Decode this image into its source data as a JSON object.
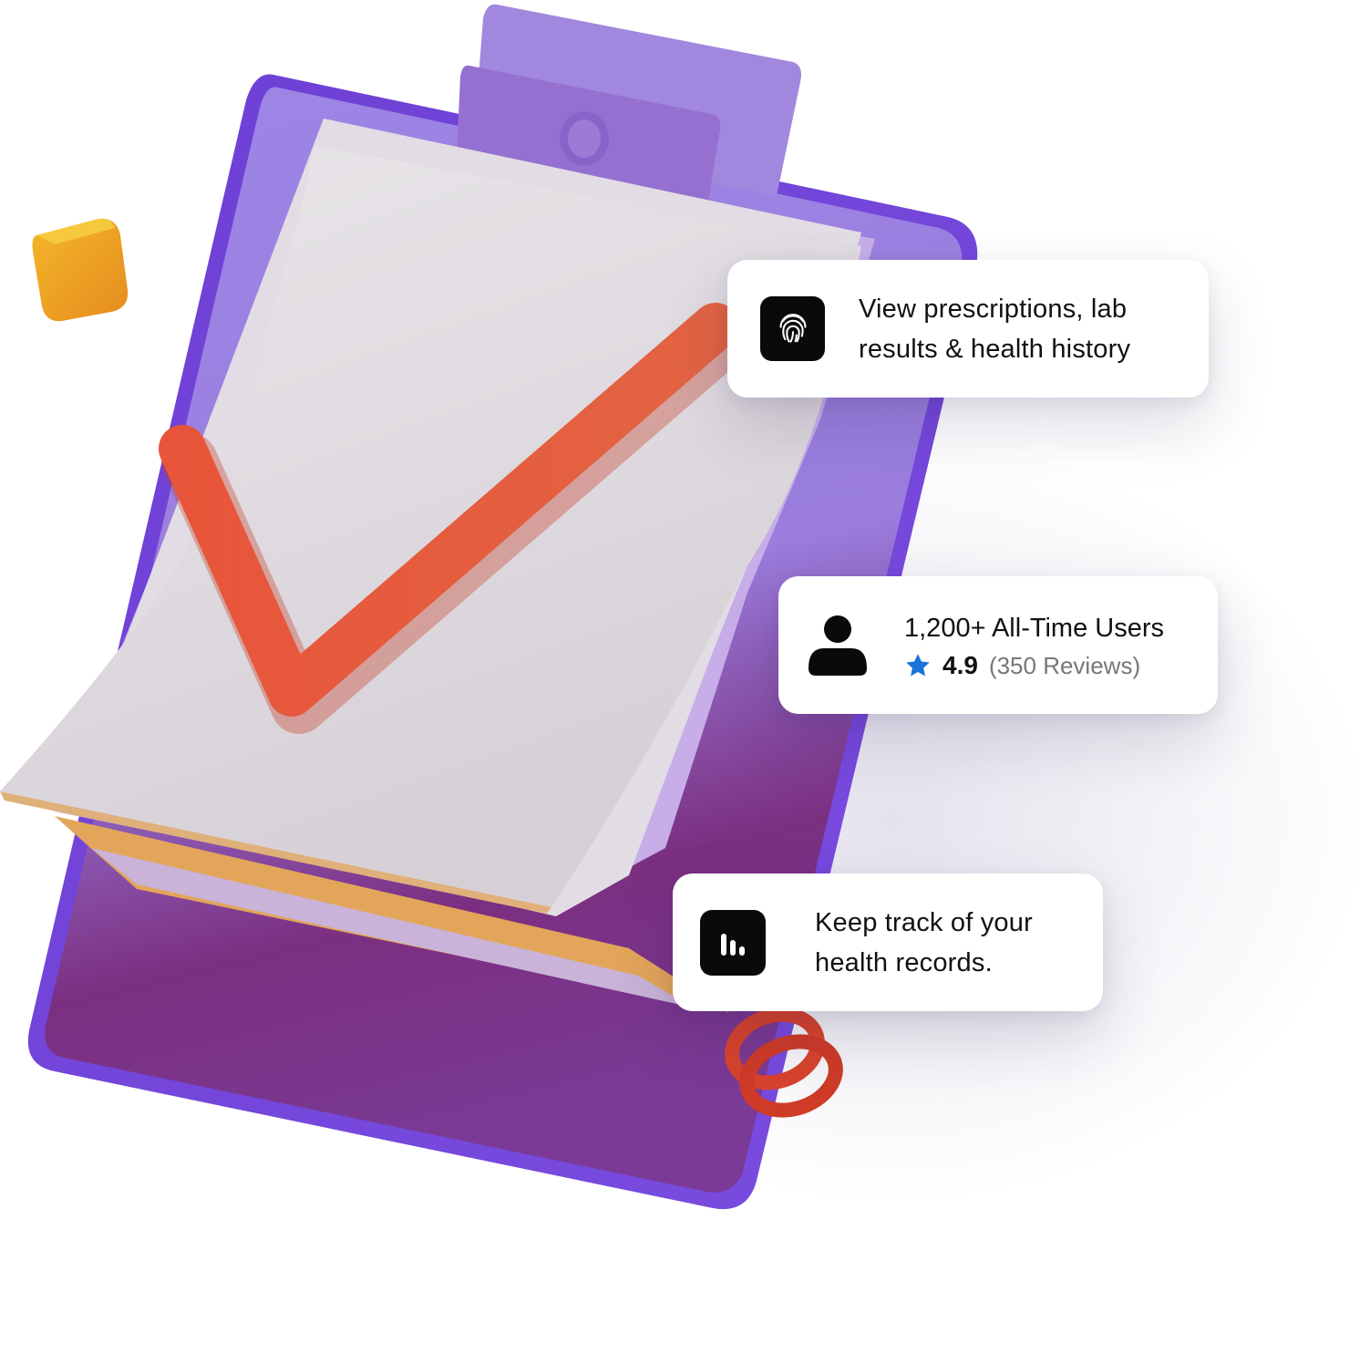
{
  "cards": {
    "records": {
      "icon": "fingerprint-icon",
      "line1": "View prescriptions, lab",
      "line2": "results & health history"
    },
    "users": {
      "icon": "user-icon",
      "title": "1,200+ All-Time Users",
      "rating": "4.9",
      "reviews": "(350 Reviews)",
      "star_icon": "star-icon",
      "star_color": "#1a73d9"
    },
    "tracking": {
      "icon": "bar-chart-icon",
      "line1": "Keep track of your",
      "line2": "health records."
    }
  },
  "illustration": {
    "subject": "clipboard-with-checkmark-illustration",
    "colors": {
      "clipboard": "#9b7fe0",
      "clipboard_dark": "#7a2f82",
      "paper": "#ddd8df",
      "checkmark": "#e8613c",
      "cube": "#f0a020",
      "spring": "#d8432c"
    }
  }
}
